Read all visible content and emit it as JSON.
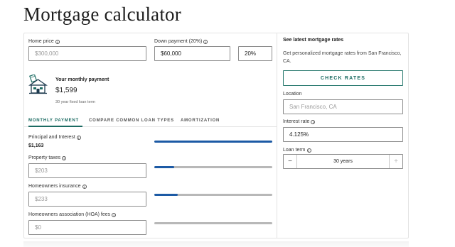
{
  "page": {
    "title": "Mortgage calculator"
  },
  "inputs": {
    "home_price": {
      "label": "Home price",
      "placeholder": "$300,000"
    },
    "down_payment": {
      "label": "Down payment (20%)",
      "value": "$60,000",
      "percent": "20%"
    }
  },
  "monthly": {
    "title": "Your monthly payment",
    "value": "$1,599",
    "subtitle": "30 year fixed loan term",
    "icon": "house-calculator-icon"
  },
  "tabs": [
    {
      "label": "MONTHLY PAYMENT",
      "active": true
    },
    {
      "label": "COMPARE COMMON LOAN TYPES",
      "active": false
    },
    {
      "label": "AMORTIZATION",
      "active": false
    }
  ],
  "breakdown": {
    "principal": {
      "label": "Principal and Interest",
      "value": "$1,163",
      "bar_fraction": 1.0
    },
    "property_taxes": {
      "label": "Property taxes",
      "placeholder": "$203",
      "bar_fraction": 0.17
    },
    "insurance": {
      "label": "Homeowners insurance",
      "placeholder": "$233",
      "bar_fraction": 0.2
    },
    "hoa": {
      "label": "Homeowners association (HOA) fees",
      "placeholder": "$0",
      "bar_fraction": 0
    }
  },
  "rates": {
    "title": "See latest mortgage rates",
    "description": "Get personalized mortgage rates from San Francisco, CA.",
    "button": "CHECK RATES",
    "location": {
      "label": "Location",
      "placeholder": "San Francisco, CA"
    },
    "interest": {
      "label": "Interest rate",
      "value": "4.125%"
    },
    "loan_term": {
      "label": "Loan term",
      "value": "30 years",
      "minus": "−",
      "plus": "+"
    }
  },
  "colors": {
    "accent": "#1b6b62",
    "bar": "#1c5aa5",
    "bar_track": "#b8b8b8"
  }
}
